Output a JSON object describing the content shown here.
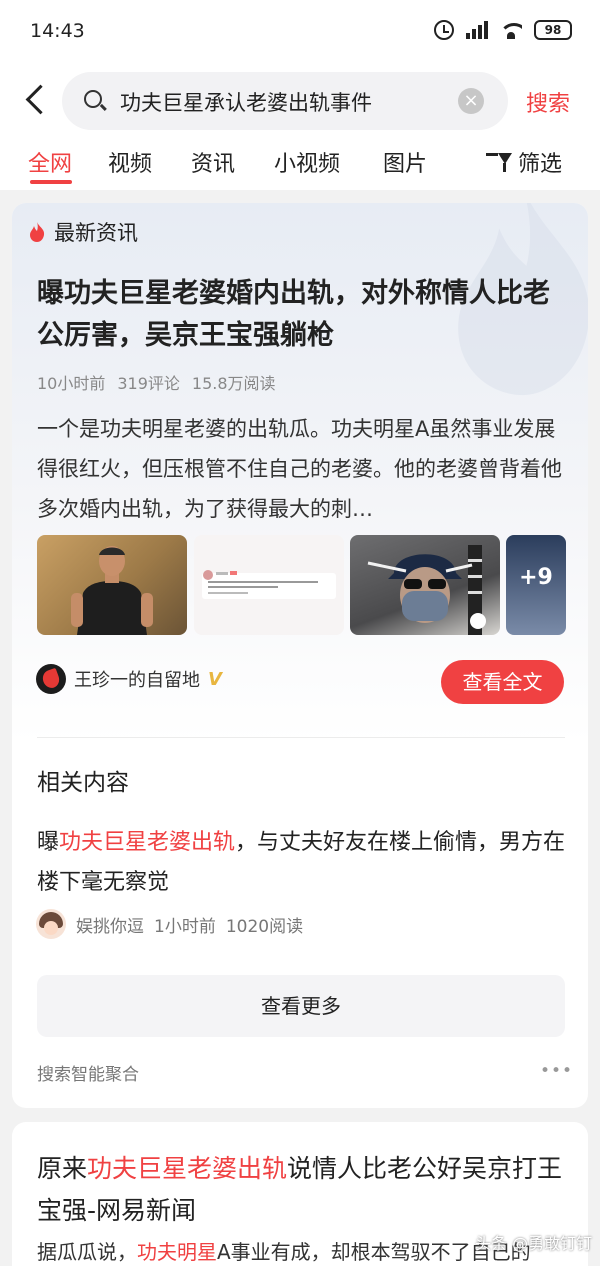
{
  "status_bar": {
    "time": "14:43",
    "battery": "98"
  },
  "search": {
    "query": "功夫巨星承认老婆出轨事件",
    "clear_glyph": "×",
    "submit_label": "搜索"
  },
  "tabs": [
    {
      "label": "全网",
      "active": true
    },
    {
      "label": "视频"
    },
    {
      "label": "资讯"
    },
    {
      "label": "小视频"
    },
    {
      "label": "图片"
    }
  ],
  "filter_label": "筛选",
  "news_card": {
    "section_title": "最新资讯",
    "headline": "曝功夫巨星老婆婚内出轨，对外称情人比老公厉害，吴京王宝强躺枪",
    "meta": {
      "time": "10小时前",
      "comments": "319评论",
      "reads": "15.8万阅读"
    },
    "summary": "一个是功夫明星老婆的出轨瓜。功夫明星A虽然事业发展得很红火，但压根管不住自己的老婆。他的老婆曾背着他多次婚内出轨，为了获得最大的刺…",
    "extra_images": "+9",
    "author": "王珍一的自留地",
    "verified_mark": "V",
    "read_full_label": "查看全文",
    "accent_color": "#f04142"
  },
  "related": {
    "title": "相关内容",
    "item": {
      "prefix": "曝",
      "highlight": "功夫巨星老婆出轨",
      "rest": "，与丈夫好友在楼上偷情，男方在楼下毫无察觉",
      "author": "娱挑你逗",
      "time": "1小时前",
      "reads": "1020阅读"
    },
    "more_label": "查看更多",
    "aggregation_label": "搜索智能聚合",
    "more_glyph": "•••"
  },
  "second_result": {
    "headline_prefix": "原来",
    "headline_highlight": "功夫巨星老婆出轨",
    "headline_rest": "说情人比老公好吴京打王宝强-网易新闻",
    "summary_prefix": "据瓜瓜说，",
    "summary_highlight": "功夫明星",
    "summary_rest": "A事业有成，却根本驾驭不了自己的"
  },
  "watermark": "头条 @勇敢钉钉"
}
